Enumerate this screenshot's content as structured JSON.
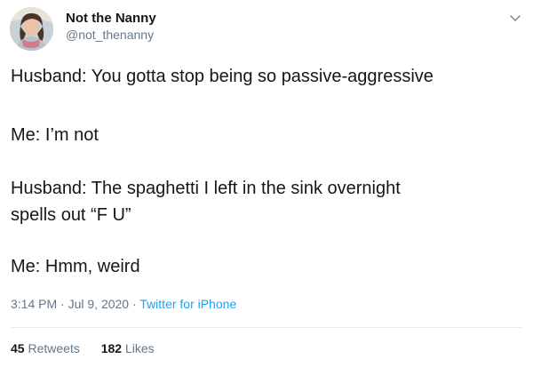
{
  "author": {
    "display_name": "Not the Nanny",
    "handle": "@not_thenanny"
  },
  "tweet": {
    "lines": [
      "Husband: You gotta stop being so passive-aggressive",
      "Me: I’m not",
      "Husband: The spaghetti I left in the sink overnight",
      "spells out “F U”",
      "Me: Hmm, weird"
    ]
  },
  "meta": {
    "time": "3:14 PM",
    "separator1": " · ",
    "date": "Jul 9, 2020",
    "separator2": " · ",
    "source": "Twitter for iPhone"
  },
  "stats": {
    "retweets_count": "45",
    "retweets_label": "Retweets",
    "likes_count": "182",
    "likes_label": "Likes"
  },
  "icons": {
    "menu": "chevron-down-icon"
  },
  "colors": {
    "text": "#14171a",
    "muted": "#657786",
    "link": "#1da1f2",
    "divider": "#e6ecf0"
  }
}
